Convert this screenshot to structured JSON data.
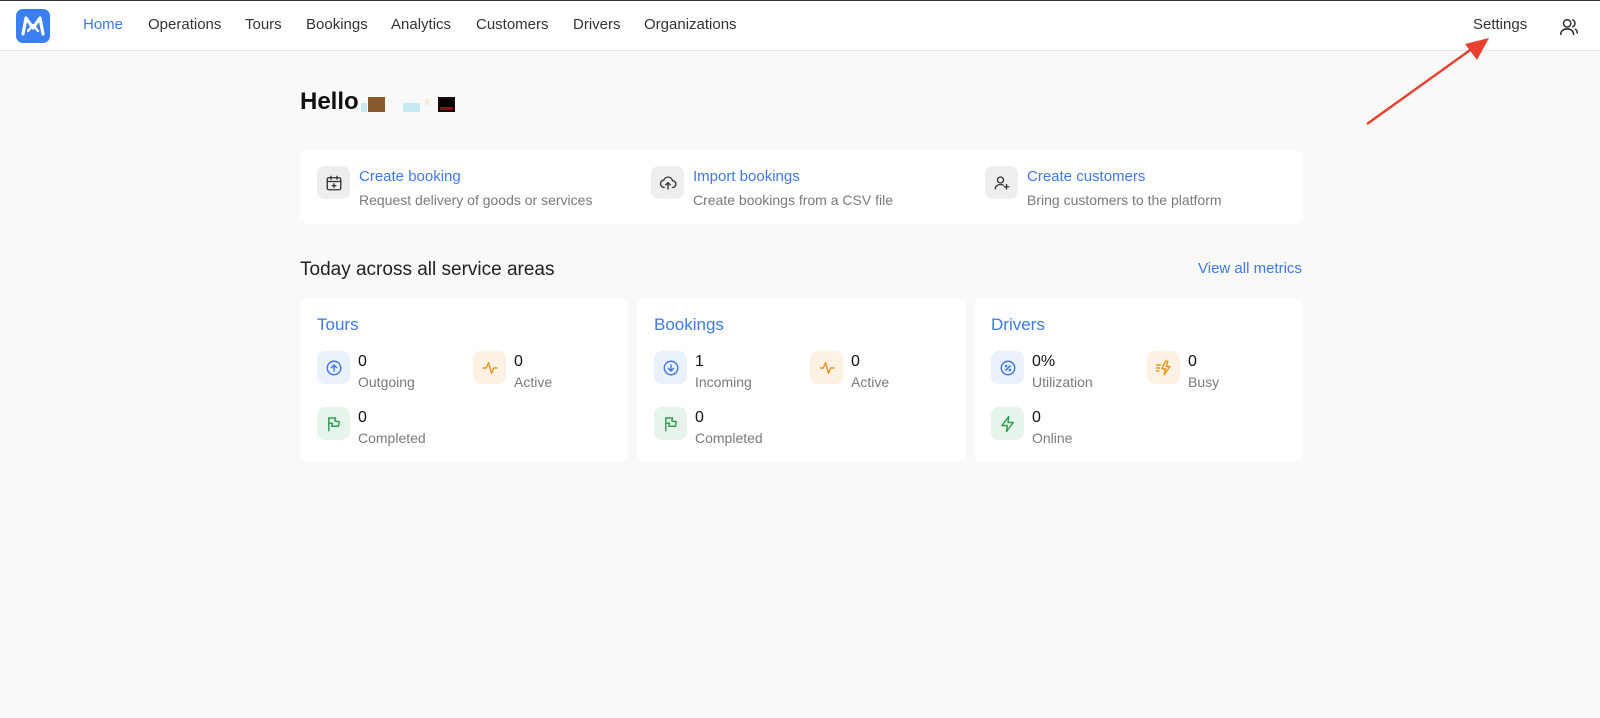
{
  "nav": {
    "items": [
      {
        "label": "Home",
        "active": true
      },
      {
        "label": "Operations",
        "active": false
      },
      {
        "label": "Tours",
        "active": false
      },
      {
        "label": "Bookings",
        "active": false
      },
      {
        "label": "Analytics",
        "active": false
      },
      {
        "label": "Customers",
        "active": false
      },
      {
        "label": "Drivers",
        "active": false
      },
      {
        "label": "Organizations",
        "active": false
      }
    ],
    "settings_label": "Settings",
    "user_icon": "user-icon",
    "logo_icon": "m-logo-icon"
  },
  "greeting": {
    "text": "Hello"
  },
  "actions": [
    {
      "title": "Create booking",
      "description": "Request delivery of goods or services",
      "icon": "calendar-plus-icon"
    },
    {
      "title": "Import bookings",
      "description": "Create bookings from a CSV file",
      "icon": "cloud-upload-icon"
    },
    {
      "title": "Create customers",
      "description": "Bring customers to the platform",
      "icon": "user-plus-icon"
    }
  ],
  "section": {
    "title": "Today across all service areas",
    "view_all_label": "View all metrics"
  },
  "cards": [
    {
      "title": "Tours",
      "metrics": [
        {
          "value": "0",
          "label": "Outgoing",
          "icon": "arrow-up-circle-icon",
          "tone": "blue"
        },
        {
          "value": "0",
          "label": "Active",
          "icon": "activity-icon",
          "tone": "orange"
        },
        {
          "value": "0",
          "label": "Completed",
          "icon": "flag-icon",
          "tone": "green"
        }
      ]
    },
    {
      "title": "Bookings",
      "metrics": [
        {
          "value": "1",
          "label": "Incoming",
          "icon": "arrow-down-circle-icon",
          "tone": "blue"
        },
        {
          "value": "0",
          "label": "Active",
          "icon": "activity-icon",
          "tone": "orange"
        },
        {
          "value": "0",
          "label": "Completed",
          "icon": "flag-icon",
          "tone": "green"
        }
      ]
    },
    {
      "title": "Drivers",
      "metrics": [
        {
          "value": "0%",
          "label": "Utilization",
          "icon": "percent-circle-icon",
          "tone": "blue"
        },
        {
          "value": "0",
          "label": "Busy",
          "icon": "zap-fast-icon",
          "tone": "orange"
        },
        {
          "value": "0",
          "label": "Online",
          "icon": "zap-icon",
          "tone": "green"
        }
      ]
    }
  ],
  "colors": {
    "accent": "#3f79e6",
    "logo": "#3b7ff3",
    "annotation_arrow": "#e8402f"
  }
}
